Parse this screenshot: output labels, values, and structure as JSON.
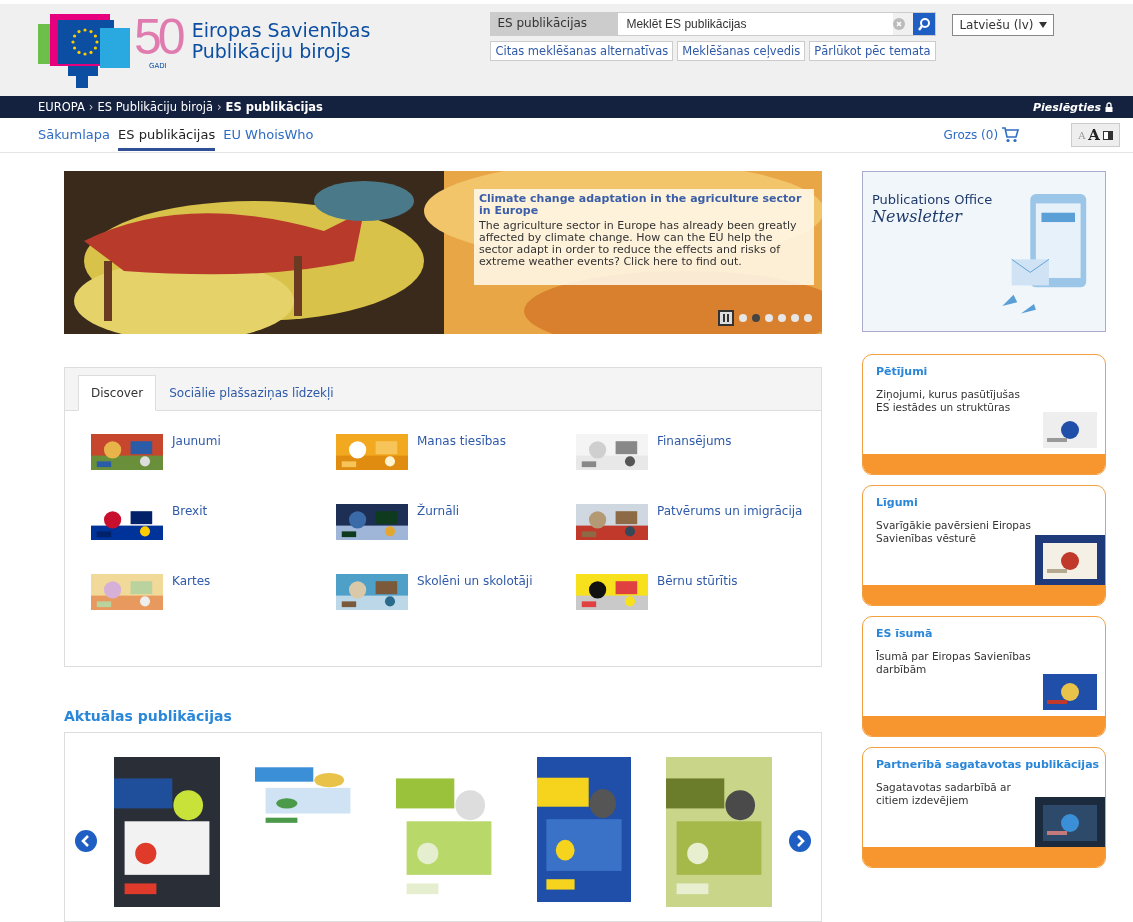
{
  "header": {
    "logo": {
      "mark": "50",
      "sub": "GADI",
      "title_lines": [
        "Eiropas Savienības",
        "Publikāciju birojs"
      ]
    },
    "search": {
      "scope": "ES publikācijas",
      "placeholder": "Meklēt ES publikācijas"
    },
    "search_links": [
      "Citas meklēšanas alternatīvas",
      "Meklēšanas ceļvedis",
      "Pārlūkot pēc temata"
    ],
    "language": "Latviešu (lv)"
  },
  "breadcrumb": {
    "items": [
      {
        "label": "EUROPA",
        "current": false
      },
      {
        "label": "ES Publikāciju birojā",
        "current": false
      },
      {
        "label": "ES publikācijas",
        "current": true
      }
    ],
    "separator": "›",
    "login": "Pieslēgties"
  },
  "nav": {
    "tabs": [
      {
        "label": "Sākumlapa",
        "selected": false
      },
      {
        "label": "ES publikācijas",
        "selected": true
      },
      {
        "label": "EU WhoisWho",
        "selected": false
      }
    ],
    "cart": "Grozs (0)",
    "font_buttons": [
      "A",
      "A"
    ]
  },
  "slider": {
    "title": "Climate change adaptation in the agriculture sector in Europe",
    "text": "The agriculture sector in Europe has already been greatly affected by climate change. How can the EU help the sector adapt in order to reduce the effects and risks of extreme weather events? Click here to find out.",
    "dots": [
      {
        "selected": false
      },
      {
        "selected": true
      },
      {
        "selected": false
      },
      {
        "selected": false
      },
      {
        "selected": false
      },
      {
        "selected": false
      }
    ]
  },
  "discover": {
    "tabs": [
      {
        "label": "Discover",
        "selected": true
      },
      {
        "label": "Sociālie plašsaziņas līdzekļi",
        "selected": false
      }
    ],
    "items": [
      {
        "label": "Jaunumi"
      },
      {
        "label": "Manas tiesības"
      },
      {
        "label": "Finansējums"
      },
      {
        "label": "Brexit"
      },
      {
        "label": "Žurnāli"
      },
      {
        "label": "Patvērums un imigrācija"
      },
      {
        "label": "Kartes"
      },
      {
        "label": "Skolēni un skolotāji"
      },
      {
        "label": "Bērnu stūrītis"
      }
    ]
  },
  "recent": {
    "heading": "Aktuālas publikācijas"
  },
  "sidebar": {
    "newsletter": {
      "line1": "Publications Office",
      "line2": "Newsletter"
    },
    "cards": [
      {
        "title": "Pētījumi",
        "text": "Ziņojumi, kurus pasūtījušas ES iestādes un struktūras"
      },
      {
        "title": "Līgumi",
        "text": "Svarīgākie pavērsieni Eiropas Savienības vēsturē"
      },
      {
        "title": "ES īsumā",
        "text": "Īsumā par Eiropas Savienības darbībām"
      },
      {
        "title": "Partnerībā sagatavotas publikācijas",
        "text": "Sagatavotas sadarbībā ar citiem izdevējiem"
      }
    ]
  }
}
